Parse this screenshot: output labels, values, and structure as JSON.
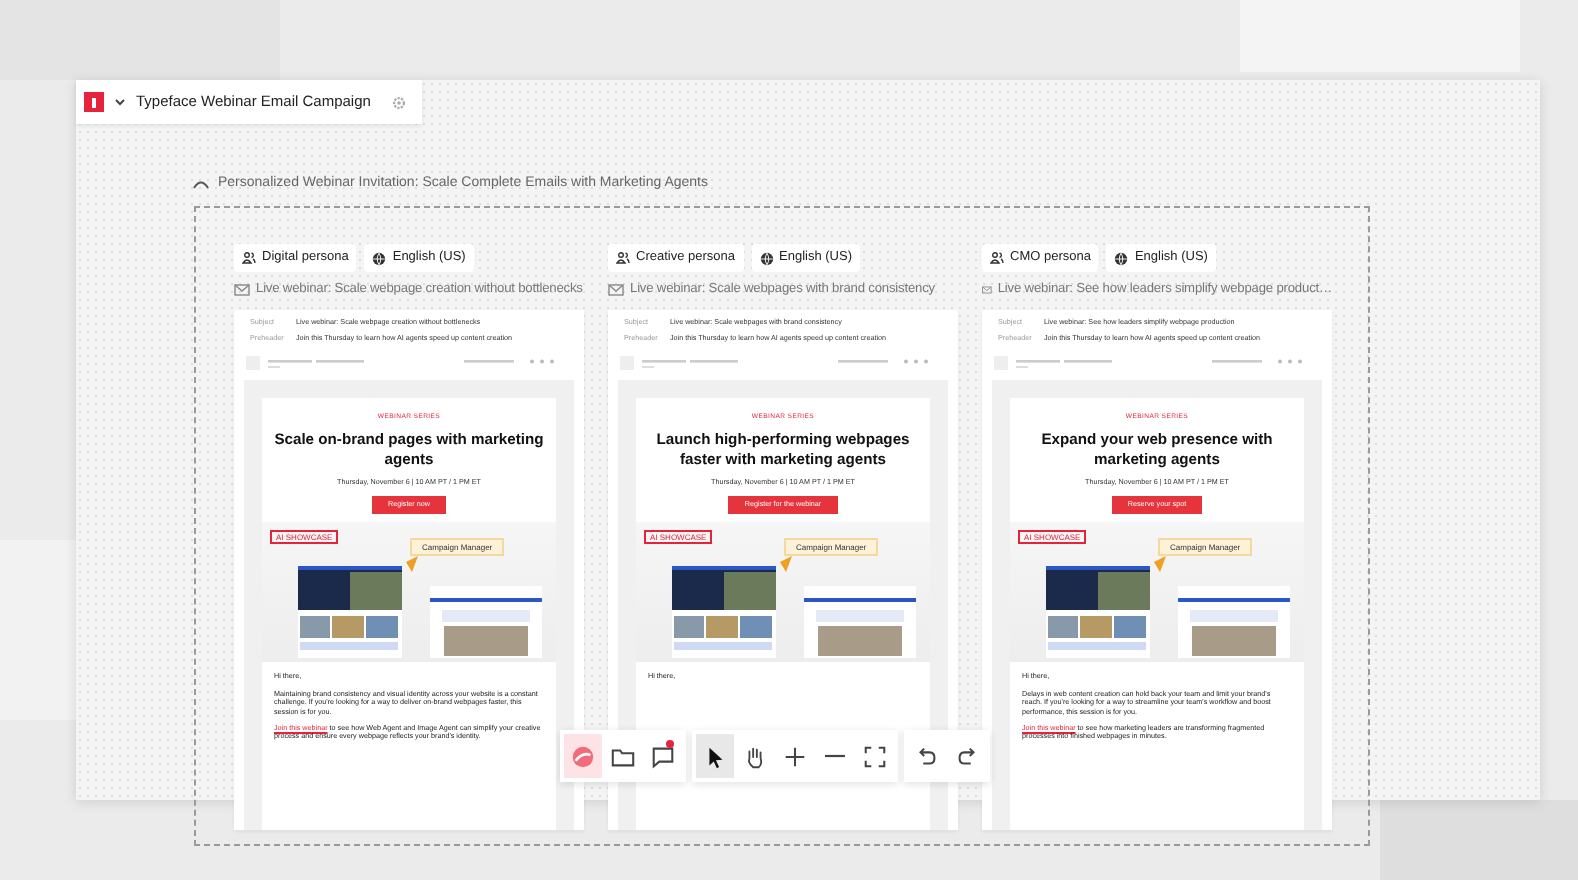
{
  "document": {
    "title": "Typeface Webinar Email Campaign"
  },
  "section": {
    "title": "Personalized Webinar Invitation: Scale Complete Emails with Marketing Agents",
    "expanded": true
  },
  "variants": [
    {
      "persona": "Digital persona",
      "language": "English (US)",
      "subject_line": "Live webinar: Scale webpage creation without bottlenecks",
      "fields": [
        {
          "label": "Subject",
          "value": "Live webinar: Scale webpage creation without bottlenecks"
        },
        {
          "label": "Preheader",
          "value": "Join this Thursday to learn how AI agents speed up content creation"
        }
      ],
      "eyebrow": "WEBINAR SERIES",
      "heading": "Scale on-brand pages with marketing agents",
      "date": "Thursday, November 6 | 10 AM PT / 1 PM ET",
      "cta": "Register now",
      "showcase_tag": "AI SHOWCASE",
      "badge": "Campaign Manager",
      "greeting": "Hi there,",
      "paragraphs": [
        {
          "text": "Maintaining brand consistency and visual identity across your website is a constant challenge. If you're looking for a way to deliver on-brand webpages faster, this session is for you."
        },
        {
          "link": "Join this webinar",
          "text": " to see how Web Agent and Image Agent can simplify your creative process and ensure every webpage reflects your brand's identity."
        }
      ]
    },
    {
      "persona": "Creative persona",
      "language": "English (US)",
      "subject_line": "Live webinar: Scale webpages with brand consistency",
      "fields": [
        {
          "label": "Subject",
          "value": "Live webinar: Scale webpages with brand consistency"
        },
        {
          "label": "Preheader",
          "value": "Join this Thursday to learn how AI agents speed up content creation"
        }
      ],
      "eyebrow": "WEBINAR SERIES",
      "heading": "Launch high-performing webpages faster with marketing agents",
      "date": "Thursday, November 6 | 10 AM PT / 1 PM ET",
      "cta": "Register for the webinar",
      "showcase_tag": "AI SHOWCASE",
      "badge": "Campaign Manager",
      "greeting": "Hi there,"
    },
    {
      "persona": "CMO persona",
      "language": "English (US)",
      "subject_line": "Live webinar: See how leaders simplify webpage product…",
      "fields": [
        {
          "label": "Subject",
          "value": "Live webinar: See how leaders simplify webpage production"
        },
        {
          "label": "Preheader",
          "value": "Join this Thursday to learn how AI agents speed up content creation"
        }
      ],
      "eyebrow": "WEBINAR SERIES",
      "heading": "Expand your web presence with marketing agents",
      "date": "Thursday, November 6 | 10 AM PT / 1 PM ET",
      "cta": "Reserve your spot",
      "showcase_tag": "AI SHOWCASE",
      "badge": "Campaign Manager",
      "greeting": "Hi there,",
      "paragraphs": [
        {
          "text": "Delays in web content creation can hold back your team and limit your brand's reach. If you're looking for a way to streamline your team's workflow and boost performance, this session is for you."
        },
        {
          "link": "Join this webinar",
          "text": " to see how marketing leaders are transforming fragmented processes into finished webpages in minutes."
        }
      ]
    }
  ],
  "toolbar": [
    {
      "kind": "logo",
      "selected": true
    },
    {
      "kind": "folder",
      "selected": false
    },
    {
      "kind": "comment",
      "selected": false,
      "badge": true
    },
    {
      "kind": "separator"
    },
    {
      "kind": "pointer",
      "selected": true
    },
    {
      "kind": "hand",
      "selected": false
    },
    {
      "kind": "zoom-in",
      "selected": false
    },
    {
      "kind": "zoom-out",
      "selected": false
    },
    {
      "kind": "fit",
      "selected": false
    },
    {
      "kind": "separator"
    },
    {
      "kind": "undo",
      "selected": false
    },
    {
      "kind": "redo",
      "selected": false
    }
  ]
}
